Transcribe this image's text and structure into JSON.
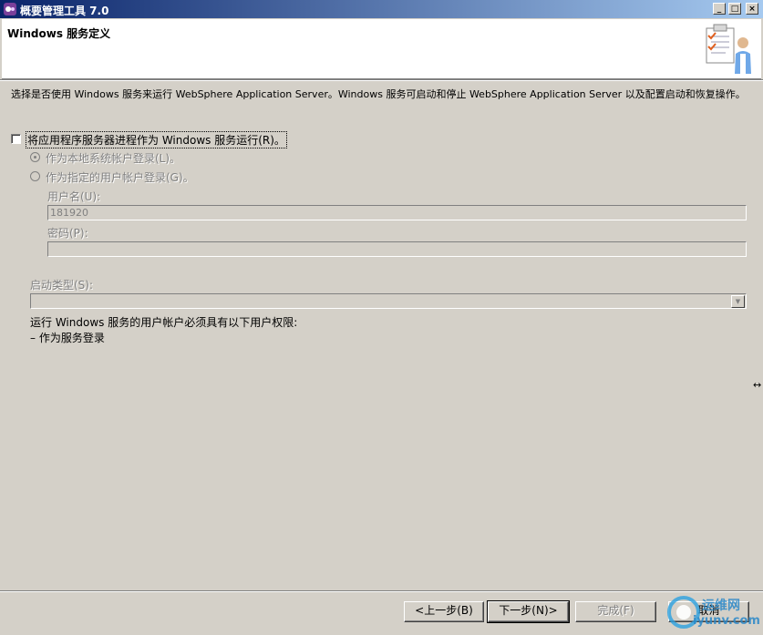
{
  "window": {
    "title": "概要管理工具 7.0",
    "minimize_glyph": "_",
    "maximize_glyph": "□",
    "close_glyph": "×"
  },
  "header": {
    "title": "Windows 服务定义",
    "icon": "wizard-clipboard-person-icon"
  },
  "main": {
    "description": "选择是否使用 Windows 服务来运行 WebSphere Application Server。Windows 服务可启动和停止 WebSphere Application Server 以及配置启动和恢复操作。",
    "run_as_service_label": "将应用程序服务器进程作为 Windows 服务运行(R)。",
    "run_as_service_checked": false,
    "logon_local_label": "作为本地系统帐户登录(L)。",
    "logon_user_label": "作为指定的用户帐户登录(G)。",
    "username_label": "用户名(U):",
    "username_value": "181920",
    "password_label": "密码(P):",
    "password_value": "",
    "startup_type_label": "启动类型(S):",
    "startup_type_value": "",
    "rights_note": "运行 Windows 服务的用户帐户必须具有以下用户权限:",
    "rights_items": [
      "–  作为服务登录"
    ]
  },
  "footer": {
    "back_label": "<上一步(B)",
    "next_label": "下一步(N)>",
    "finish_label": "完成(F)",
    "cancel_label": "取消"
  },
  "watermark": {
    "text_top": "运维网",
    "text_bottom": "iyunv.com"
  }
}
